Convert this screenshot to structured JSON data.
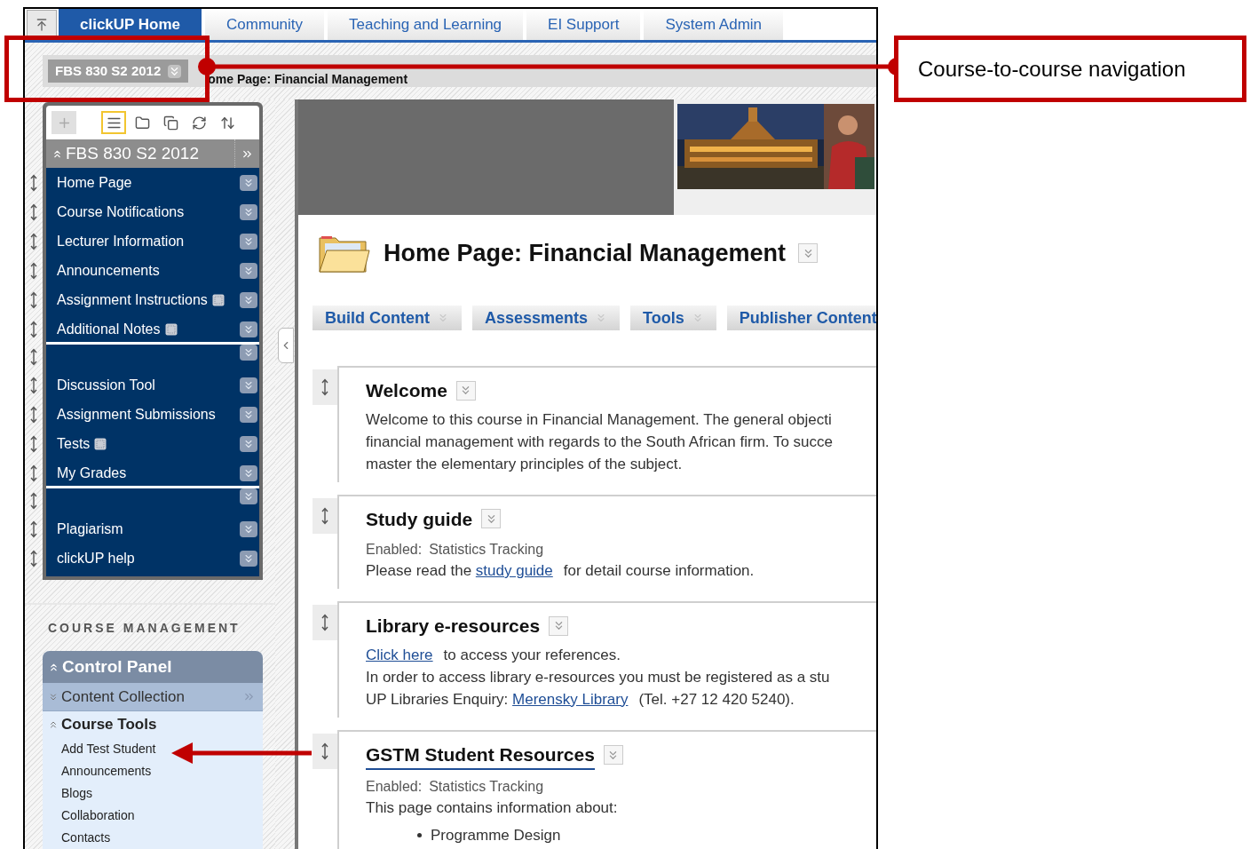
{
  "top_tabs": [
    {
      "label": "clickUP Home",
      "selected": true
    },
    {
      "label": "Community",
      "selected": false
    },
    {
      "label": "Teaching and Learning",
      "selected": false
    },
    {
      "label": "EI Support",
      "selected": false
    },
    {
      "label": "System Admin",
      "selected": false
    }
  ],
  "course_button": {
    "label": "FBS 830 S2 2012"
  },
  "breadcrumb": "ome Page: Financial Management",
  "course_menu": {
    "toolbar": [
      {
        "kind": "add",
        "selected": false
      },
      {
        "kind": "list",
        "selected": true
      },
      {
        "kind": "folder",
        "selected": false
      },
      {
        "kind": "windows",
        "selected": false
      },
      {
        "kind": "refresh",
        "selected": false
      },
      {
        "kind": "sort",
        "selected": false
      }
    ],
    "title": "FBS 830 S2 2012",
    "expanded": true,
    "items": [
      {
        "kind": "link",
        "label": "Home Page",
        "marker": false
      },
      {
        "kind": "link",
        "label": "Course Notifications",
        "marker": false
      },
      {
        "kind": "link",
        "label": "Lecturer Information",
        "marker": false
      },
      {
        "kind": "link",
        "label": "Announcements",
        "marker": false
      },
      {
        "kind": "link",
        "label": "Assignment Instructions",
        "marker": true
      },
      {
        "kind": "link",
        "label": "Additional Notes",
        "marker": true
      },
      {
        "kind": "divider"
      },
      {
        "kind": "link",
        "label": "Discussion Tool",
        "marker": false
      },
      {
        "kind": "link",
        "label": "Assignment Submissions",
        "marker": false
      },
      {
        "kind": "link",
        "label": "Tests",
        "marker": true
      },
      {
        "kind": "link",
        "label": "My Grades",
        "marker": false
      },
      {
        "kind": "divider"
      },
      {
        "kind": "link",
        "label": "Plagiarism",
        "marker": false
      },
      {
        "kind": "link",
        "label": "clickUP help",
        "marker": false
      }
    ]
  },
  "course_management": {
    "heading": "COURSE MANAGEMENT",
    "control_panel": {
      "title": "Control Panel",
      "expanded": true,
      "sections": [
        {
          "label": "Content Collection",
          "expanded": false
        },
        {
          "label": "Course Tools",
          "expanded": true,
          "items": [
            "Add Test Student",
            "Announcements",
            "Blogs",
            "Collaboration",
            "Contacts"
          ]
        }
      ]
    }
  },
  "page": {
    "title": "Home Page: Financial Management",
    "action_buttons": [
      "Build Content",
      "Assessments",
      "Tools",
      "Publisher Content"
    ],
    "content_items": [
      {
        "title": "Welcome",
        "title_link": false,
        "paragraphs": [
          [
            {
              "text": "Welcome to this course in Financial Management. The general objecti",
              "link": false
            }
          ],
          [
            {
              "text": "financial management with regards to the South African firm. To succe",
              "link": false
            }
          ],
          [
            {
              "text": "master the elementary principles of the subject.",
              "link": false
            }
          ]
        ]
      },
      {
        "title": "Study guide",
        "title_link": false,
        "meta": {
          "label": "Enabled:",
          "value": "Statistics Tracking"
        },
        "paragraphs": [
          [
            {
              "text": "Please read the",
              "link": false
            },
            {
              "text": "study guide",
              "link": true
            },
            {
              "text": "for detail course information.",
              "link": false
            }
          ]
        ]
      },
      {
        "title": "Library e-resources",
        "title_link": false,
        "paragraphs": [
          [
            {
              "text": "Click here",
              "link": true
            },
            {
              "text": "to access your references.",
              "link": false
            }
          ],
          [
            {
              "text": "In order to access library e-resources you must be registered as a stu",
              "link": false
            }
          ],
          [
            {
              "text": "UP Libraries Enquiry:",
              "link": false
            },
            {
              "text": "Merensky Library",
              "link": true
            },
            {
              "text": "(Tel. +27 12 420 5240).",
              "link": false
            }
          ]
        ]
      },
      {
        "title": "GSTM Student Resources",
        "title_link": true,
        "meta": {
          "label": "Enabled:",
          "value": "Statistics Tracking"
        },
        "paragraphs": [
          [
            {
              "text": "This page contains information about:",
              "link": false
            }
          ]
        ],
        "bullets": [
          "Programme Design"
        ]
      }
    ]
  },
  "annotations": {
    "callout": "Course-to-course navigation"
  }
}
